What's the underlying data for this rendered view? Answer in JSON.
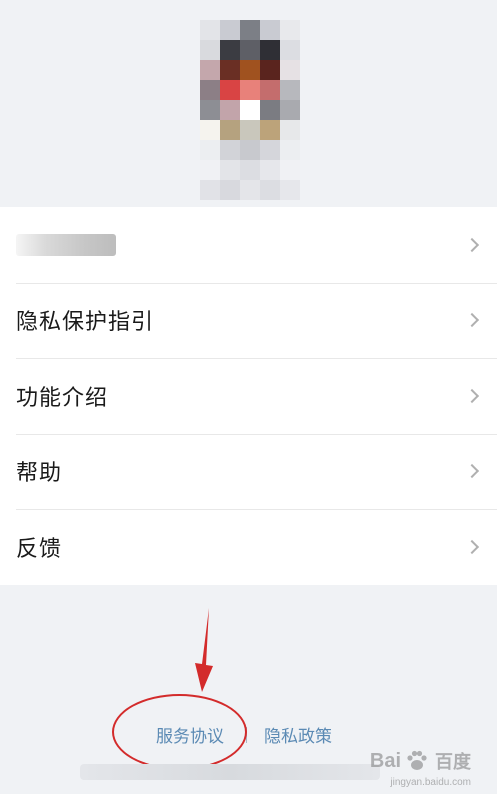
{
  "menu": {
    "items": [
      {
        "label": ""
      },
      {
        "label": "隐私保护指引"
      },
      {
        "label": "功能介绍"
      },
      {
        "label": "帮助"
      },
      {
        "label": "反馈"
      }
    ]
  },
  "footer": {
    "service_agreement": "服务协议",
    "privacy_policy": "隐私政策"
  },
  "watermark": {
    "brand": "Bai",
    "brand_zh": "百度",
    "sub": "jingyan.baidu.com"
  },
  "icons": {
    "row_chevron": "chevron-right-icon",
    "annotation": "red-arrow-and-circle"
  },
  "colors": {
    "background": "#f0f2f5",
    "link": "#5b8ab4",
    "annotation": "#d32b2b"
  }
}
